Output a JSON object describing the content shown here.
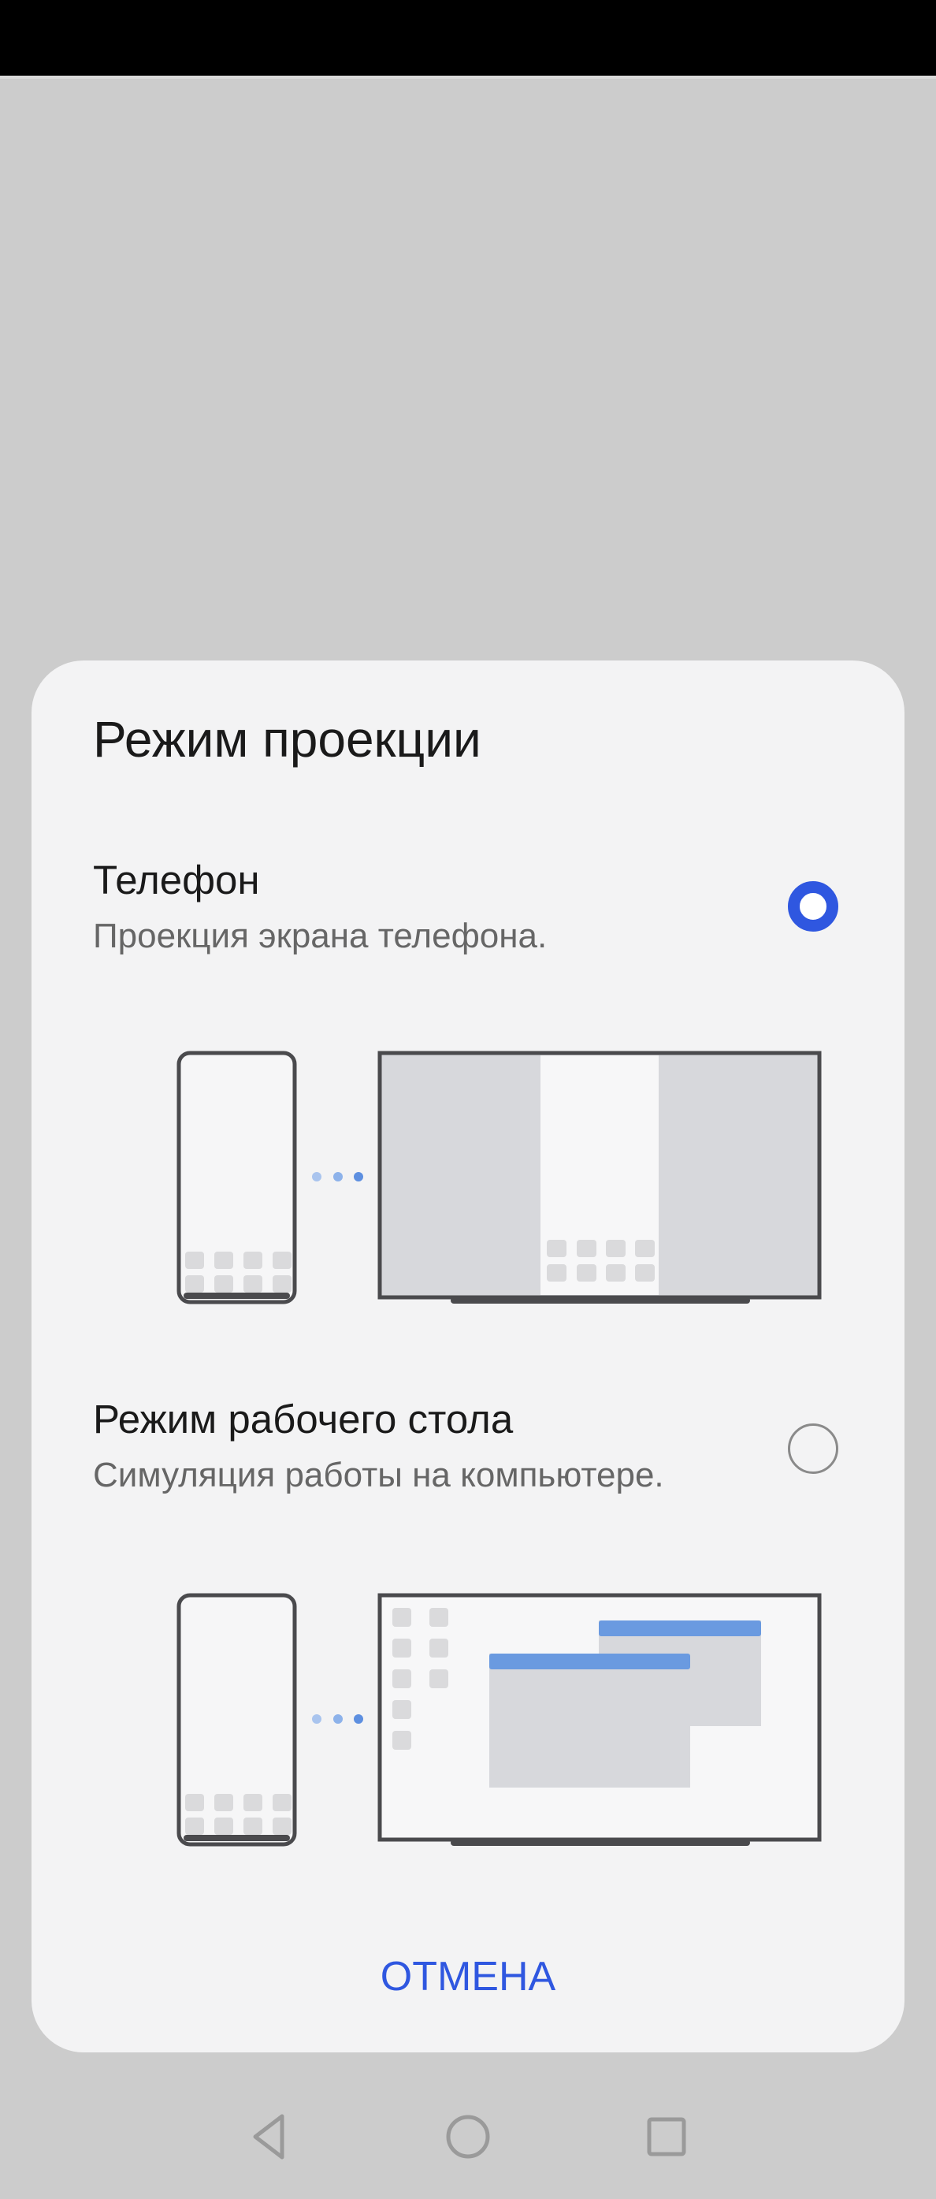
{
  "dialog": {
    "title": "Режим проекции",
    "options": [
      {
        "title": "Телефон",
        "subtitle": "Проекция экрана телефона.",
        "selected": true,
        "illustration": "phone-mirror-illustration"
      },
      {
        "title": "Режим рабочего стола",
        "subtitle": "Симуляция работы на компьютере.",
        "selected": false,
        "illustration": "desktop-mode-illustration"
      }
    ],
    "cancel_label": "ОТМЕНА"
  },
  "navigation": {
    "buttons": [
      "back-icon",
      "home-icon",
      "recents-icon"
    ]
  },
  "colors": {
    "accent": "#2f57e0",
    "dialog_background": "#f3f3f4",
    "scrim": "#cccccc",
    "window_titlebar": "#6a9ae0"
  }
}
